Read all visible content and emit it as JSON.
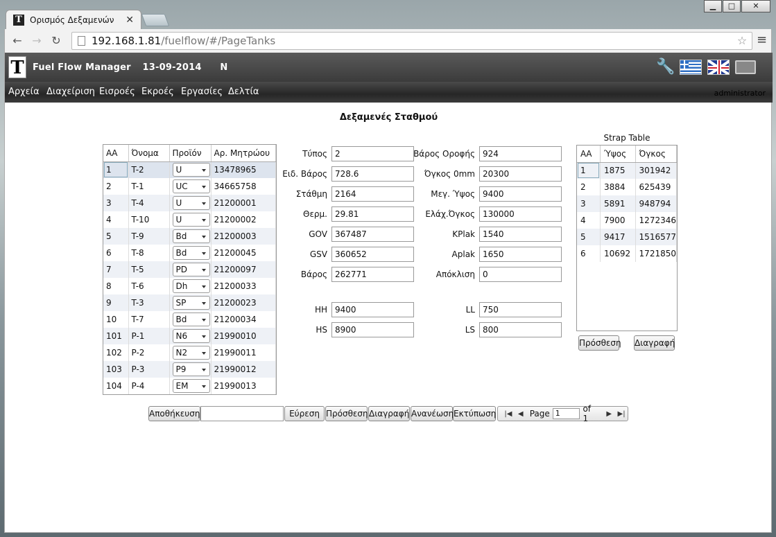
{
  "browser": {
    "tab_title": "Ορισμός Δεξαμενών",
    "url_host": "192.168.1.81",
    "url_path": "/fuelflow/#/PageTanks"
  },
  "header": {
    "app_name": "Fuel Flow Manager",
    "date": "13-09-2014",
    "flag": "N",
    "icons": [
      "wrench-icon",
      "greek-flag-icon",
      "uk-flag-icon",
      "screen-icon"
    ]
  },
  "menu": {
    "items": [
      "Αρχεία",
      "Διαχείριση",
      "Εισροές",
      "Εκροές",
      "Εργασίες",
      "Δελτία"
    ],
    "user": "administrator"
  },
  "page_title": "Δεξαμενές Σταθμού",
  "tanks_grid": {
    "columns": [
      "ΑΑ",
      "Όνομα",
      "Προϊόν",
      "Αρ. Μητρώου"
    ],
    "rows": [
      [
        "1",
        "T-2",
        "U",
        "13478965"
      ],
      [
        "2",
        "T-1",
        "UC",
        "34665758"
      ],
      [
        "3",
        "T-4",
        "U",
        "21200001"
      ],
      [
        "4",
        "T-10",
        "U",
        "21200002"
      ],
      [
        "5",
        "T-9",
        "Bd",
        "21200003"
      ],
      [
        "6",
        "T-8",
        "Bd",
        "21200045"
      ],
      [
        "7",
        "T-5",
        "PD",
        "21200097"
      ],
      [
        "8",
        "T-6",
        "Dh",
        "21200033"
      ],
      [
        "9",
        "T-3",
        "SP",
        "21200023"
      ],
      [
        "10",
        "T-7",
        "Bd",
        "21200034"
      ],
      [
        "101",
        "P-1",
        "N6",
        "21990010"
      ],
      [
        "102",
        "P-2",
        "N2",
        "21990011"
      ],
      [
        "103",
        "P-3",
        "P9",
        "21990012"
      ],
      [
        "104",
        "P-4",
        "EM",
        "21990013"
      ]
    ]
  },
  "form": {
    "left": [
      {
        "label": "Τύπος",
        "value": "2"
      },
      {
        "label": "Ειδ. Βάρος",
        "value": "728.6"
      },
      {
        "label": "Στάθμη",
        "value": "2164"
      },
      {
        "label": "Θερμ.",
        "value": "29.81"
      },
      {
        "label": "GOV",
        "value": "367487"
      },
      {
        "label": "GSV",
        "value": "360652"
      },
      {
        "label": "Βάρος",
        "value": "262771"
      }
    ],
    "right": [
      {
        "label": "Βάρος Οροφής",
        "value": "924"
      },
      {
        "label": "Όγκος 0mm",
        "value": "20300"
      },
      {
        "label": "Μεγ. Ύψος",
        "value": "9400"
      },
      {
        "label": "Ελάχ.Όγκος",
        "value": "130000"
      },
      {
        "label": "KPlak",
        "value": "1540"
      },
      {
        "label": "Aplak",
        "value": "1650"
      },
      {
        "label": "Απόκλιση",
        "value": "0"
      }
    ],
    "alarms_left": [
      {
        "label": "HH",
        "value": "9400"
      },
      {
        "label": "HS",
        "value": "8900"
      }
    ],
    "alarms_right": [
      {
        "label": "LL",
        "value": "750"
      },
      {
        "label": "LS",
        "value": "800"
      }
    ]
  },
  "strap_table": {
    "title": "Strap Table",
    "columns": [
      "ΑΑ",
      "Ύψος",
      "Όγκος"
    ],
    "rows": [
      [
        "1",
        "1875",
        "301942"
      ],
      [
        "2",
        "3884",
        "625439"
      ],
      [
        "3",
        "5891",
        "948794"
      ],
      [
        "4",
        "7900",
        "1272346"
      ],
      [
        "5",
        "9417",
        "1516577"
      ],
      [
        "6",
        "10692",
        "1721850"
      ]
    ],
    "add_label": "Πρόσθεση",
    "delete_label": "Διαγραφή"
  },
  "bottom_toolbar": {
    "save_label": "Αποθήκευση",
    "search_value": "",
    "find_label": "Εύρεση",
    "add_label": "Πρόσθεση",
    "delete_label": "Διαγραφή",
    "refresh_label": "Ανανέωση",
    "print_label": "Εκτύπωση"
  },
  "pager": {
    "page_label": "Page",
    "page_value": "1",
    "of_label": "of 1"
  }
}
